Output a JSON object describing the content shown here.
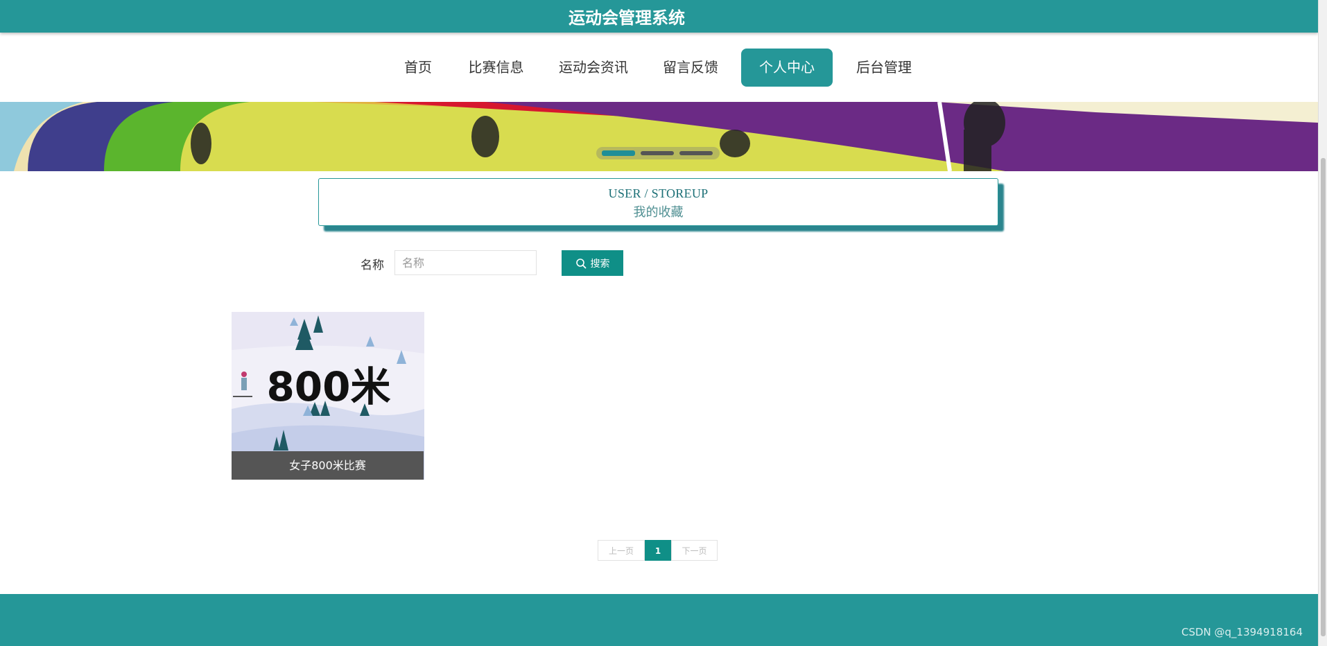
{
  "app": {
    "title": "运动会管理系统"
  },
  "nav": {
    "items": [
      {
        "label": "首页"
      },
      {
        "label": "比赛信息"
      },
      {
        "label": "运动会资讯"
      },
      {
        "label": "留言反馈"
      },
      {
        "label": "个人中心",
        "active": true
      },
      {
        "label": "后台管理"
      }
    ]
  },
  "breadcrumb": {
    "en": "USER / STOREUP",
    "cn": "我的收藏"
  },
  "search": {
    "label": "名称",
    "placeholder": "名称",
    "value": "",
    "button_label": "搜索"
  },
  "cards": [
    {
      "image_text": "800米",
      "title": "女子800米比赛"
    }
  ],
  "pagination": {
    "prev_label": "上一页",
    "current_page": "1",
    "next_label": "下一页"
  },
  "watermark": "CSDN @q_1394918164",
  "colors": {
    "primary": "#259798",
    "button": "#0f8f87",
    "card_label_bg": "#555555"
  }
}
